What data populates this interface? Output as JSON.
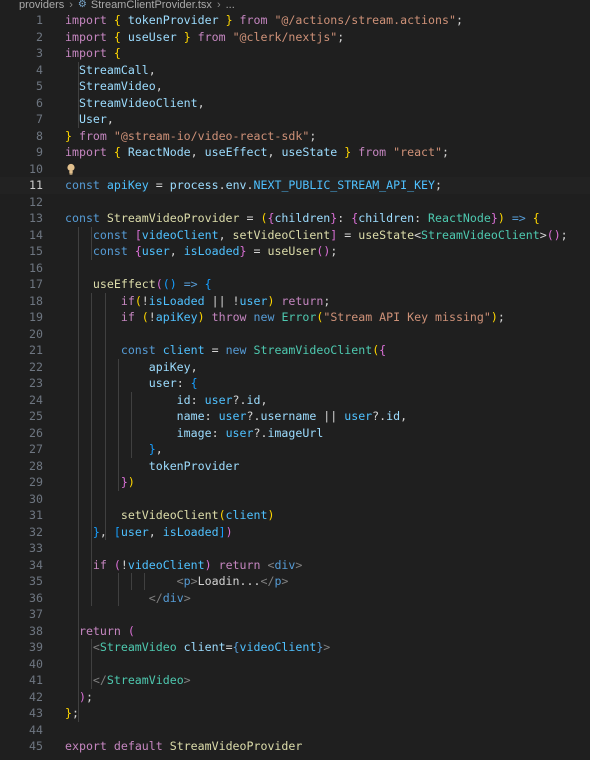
{
  "breadcrumb": {
    "folder": "providers",
    "file_icon": "gear-icon",
    "file": "StreamClientProvider.tsx",
    "more": "..."
  },
  "editor": {
    "active_line": 11,
    "lightbulb_line": 10,
    "lines": [
      {
        "n": "1",
        "tokens": [
          [
            "import",
            "ctl"
          ],
          [
            " ",
            "txt"
          ],
          [
            "{",
            "br1"
          ],
          [
            " ",
            "txt"
          ],
          [
            "tokenProvider",
            "var"
          ],
          [
            " ",
            "txt"
          ],
          [
            "}",
            "br1"
          ],
          [
            " ",
            "txt"
          ],
          [
            "from",
            "ctl"
          ],
          [
            " ",
            "txt"
          ],
          [
            "\"@/actions/stream.actions\"",
            "str"
          ],
          [
            ";",
            "txt"
          ]
        ]
      },
      {
        "n": "2",
        "tokens": [
          [
            "import",
            "ctl"
          ],
          [
            " ",
            "txt"
          ],
          [
            "{",
            "br1"
          ],
          [
            " ",
            "txt"
          ],
          [
            "useUser",
            "var"
          ],
          [
            " ",
            "txt"
          ],
          [
            "}",
            "br1"
          ],
          [
            " ",
            "txt"
          ],
          [
            "from",
            "ctl"
          ],
          [
            " ",
            "txt"
          ],
          [
            "\"@clerk/nextjs\"",
            "str"
          ],
          [
            ";",
            "txt"
          ]
        ]
      },
      {
        "n": "3",
        "tokens": [
          [
            "import",
            "ctl"
          ],
          [
            " ",
            "txt"
          ],
          [
            "{",
            "br1"
          ]
        ]
      },
      {
        "n": "4",
        "tokens": [
          [
            "  StreamCall",
            "var"
          ],
          [
            ",",
            "txt"
          ]
        ]
      },
      {
        "n": "5",
        "tokens": [
          [
            "  StreamVideo",
            "var"
          ],
          [
            ",",
            "txt"
          ]
        ]
      },
      {
        "n": "6",
        "tokens": [
          [
            "  StreamVideoClient",
            "var"
          ],
          [
            ",",
            "txt"
          ]
        ]
      },
      {
        "n": "7",
        "tokens": [
          [
            "  User",
            "var"
          ],
          [
            ",",
            "txt"
          ]
        ]
      },
      {
        "n": "8",
        "tokens": [
          [
            "}",
            "br1"
          ],
          [
            " ",
            "txt"
          ],
          [
            "from",
            "ctl"
          ],
          [
            " ",
            "txt"
          ],
          [
            "\"@stream-io/video-react-sdk\"",
            "str"
          ],
          [
            ";",
            "txt"
          ]
        ]
      },
      {
        "n": "9",
        "tokens": [
          [
            "import",
            "ctl"
          ],
          [
            " ",
            "txt"
          ],
          [
            "{",
            "br1"
          ],
          [
            " ",
            "txt"
          ],
          [
            "ReactNode",
            "var"
          ],
          [
            ", ",
            "txt"
          ],
          [
            "useEffect",
            "var"
          ],
          [
            ", ",
            "txt"
          ],
          [
            "useState",
            "var"
          ],
          [
            " ",
            "txt"
          ],
          [
            "}",
            "br1"
          ],
          [
            " ",
            "txt"
          ],
          [
            "from",
            "ctl"
          ],
          [
            " ",
            "txt"
          ],
          [
            "\"react\"",
            "str"
          ],
          [
            ";",
            "txt"
          ]
        ]
      },
      {
        "n": "10",
        "tokens": []
      },
      {
        "n": "11",
        "tokens": [
          [
            "const",
            "kw"
          ],
          [
            " ",
            "txt"
          ],
          [
            "apiKey",
            "const"
          ],
          [
            " = ",
            "txt"
          ],
          [
            "process",
            "var"
          ],
          [
            ".",
            "txt"
          ],
          [
            "env",
            "var"
          ],
          [
            ".",
            "txt"
          ],
          [
            "NEXT_PUBLIC_STREAM_API_KEY",
            "const"
          ],
          [
            ";",
            "txt"
          ]
        ]
      },
      {
        "n": "12",
        "tokens": []
      },
      {
        "n": "13",
        "tokens": [
          [
            "const",
            "kw"
          ],
          [
            " ",
            "txt"
          ],
          [
            "StreamVideoProvider",
            "fn"
          ],
          [
            " = ",
            "txt"
          ],
          [
            "(",
            "br1"
          ],
          [
            "{",
            "br2"
          ],
          [
            "children",
            "var"
          ],
          [
            "}",
            "br2"
          ],
          [
            ": ",
            "txt"
          ],
          [
            "{",
            "br2"
          ],
          [
            "children",
            "var"
          ],
          [
            ": ",
            "txt"
          ],
          [
            "ReactNode",
            "cls"
          ],
          [
            "}",
            "br2"
          ],
          [
            ")",
            "br1"
          ],
          [
            " ",
            "txt"
          ],
          [
            "=>",
            "kw"
          ],
          [
            " ",
            "txt"
          ],
          [
            "{",
            "br1"
          ]
        ]
      },
      {
        "n": "14",
        "tokens": [
          [
            "    const",
            "kw"
          ],
          [
            " ",
            "txt"
          ],
          [
            "[",
            "br2"
          ],
          [
            "videoClient",
            "const"
          ],
          [
            ", ",
            "txt"
          ],
          [
            "setVideoClient",
            "fn"
          ],
          [
            "]",
            "br2"
          ],
          [
            " = ",
            "txt"
          ],
          [
            "useState",
            "fn"
          ],
          [
            "<",
            "txt"
          ],
          [
            "StreamVideoClient",
            "cls"
          ],
          [
            ">",
            "txt"
          ],
          [
            "(",
            "br2"
          ],
          [
            ")",
            "br2"
          ],
          [
            ";",
            "txt"
          ]
        ]
      },
      {
        "n": "15",
        "tokens": [
          [
            "    const",
            "kw"
          ],
          [
            " ",
            "txt"
          ],
          [
            "{",
            "br2"
          ],
          [
            "user",
            "const"
          ],
          [
            ", ",
            "txt"
          ],
          [
            "isLoaded",
            "const"
          ],
          [
            "}",
            "br2"
          ],
          [
            " = ",
            "txt"
          ],
          [
            "useUser",
            "fn"
          ],
          [
            "(",
            "br2"
          ],
          [
            ")",
            "br2"
          ],
          [
            ";",
            "txt"
          ]
        ]
      },
      {
        "n": "16",
        "tokens": []
      },
      {
        "n": "17",
        "tokens": [
          [
            "    useEffect",
            "fn"
          ],
          [
            "(",
            "br2"
          ],
          [
            "(",
            "br3"
          ],
          [
            ")",
            "br3"
          ],
          [
            " ",
            "txt"
          ],
          [
            "=>",
            "kw"
          ],
          [
            " ",
            "txt"
          ],
          [
            "{",
            "br3"
          ]
        ]
      },
      {
        "n": "18",
        "tokens": [
          [
            "        if",
            "ctl"
          ],
          [
            "(",
            "br1"
          ],
          [
            "!",
            "txt"
          ],
          [
            "isLoaded",
            "const"
          ],
          [
            " || ",
            "txt"
          ],
          [
            "!",
            "txt"
          ],
          [
            "user",
            "const"
          ],
          [
            ")",
            "br1"
          ],
          [
            " ",
            "txt"
          ],
          [
            "return",
            "ctl"
          ],
          [
            ";",
            "txt"
          ]
        ]
      },
      {
        "n": "19",
        "tokens": [
          [
            "        if",
            "ctl"
          ],
          [
            " ",
            "txt"
          ],
          [
            "(",
            "br1"
          ],
          [
            "!",
            "txt"
          ],
          [
            "apiKey",
            "const"
          ],
          [
            ")",
            "br1"
          ],
          [
            " ",
            "txt"
          ],
          [
            "throw",
            "ctl"
          ],
          [
            " ",
            "txt"
          ],
          [
            "new",
            "kw"
          ],
          [
            " ",
            "txt"
          ],
          [
            "Error",
            "cls"
          ],
          [
            "(",
            "br1"
          ],
          [
            "\"Stream API Key missing\"",
            "str"
          ],
          [
            ")",
            "br1"
          ],
          [
            ";",
            "txt"
          ]
        ]
      },
      {
        "n": "20",
        "tokens": []
      },
      {
        "n": "21",
        "tokens": [
          [
            "        const",
            "kw"
          ],
          [
            " ",
            "txt"
          ],
          [
            "client",
            "const"
          ],
          [
            " = ",
            "txt"
          ],
          [
            "new",
            "kw"
          ],
          [
            " ",
            "txt"
          ],
          [
            "StreamVideoClient",
            "cls"
          ],
          [
            "(",
            "br1"
          ],
          [
            "{",
            "br2"
          ]
        ]
      },
      {
        "n": "22",
        "tokens": [
          [
            "            apiKey",
            "var"
          ],
          [
            ",",
            "txt"
          ]
        ]
      },
      {
        "n": "23",
        "tokens": [
          [
            "            user",
            "var"
          ],
          [
            ": ",
            "txt"
          ],
          [
            "{",
            "br3"
          ]
        ]
      },
      {
        "n": "24",
        "tokens": [
          [
            "                id",
            "var"
          ],
          [
            ": ",
            "txt"
          ],
          [
            "user",
            "const"
          ],
          [
            "?.",
            "txt"
          ],
          [
            "id",
            "var"
          ],
          [
            ",",
            "txt"
          ]
        ]
      },
      {
        "n": "25",
        "tokens": [
          [
            "                name",
            "var"
          ],
          [
            ": ",
            "txt"
          ],
          [
            "user",
            "const"
          ],
          [
            "?.",
            "txt"
          ],
          [
            "username",
            "var"
          ],
          [
            " || ",
            "txt"
          ],
          [
            "user",
            "const"
          ],
          [
            "?.",
            "txt"
          ],
          [
            "id",
            "var"
          ],
          [
            ",",
            "txt"
          ]
        ]
      },
      {
        "n": "26",
        "tokens": [
          [
            "                image",
            "var"
          ],
          [
            ": ",
            "txt"
          ],
          [
            "user",
            "const"
          ],
          [
            "?.",
            "txt"
          ],
          [
            "imageUrl",
            "var"
          ]
        ]
      },
      {
        "n": "27",
        "tokens": [
          [
            "            }",
            "br3"
          ],
          [
            ",",
            "txt"
          ]
        ]
      },
      {
        "n": "28",
        "tokens": [
          [
            "            tokenProvider",
            "var"
          ]
        ]
      },
      {
        "n": "29",
        "tokens": [
          [
            "        }",
            "br2"
          ],
          [
            ")",
            "br1"
          ]
        ]
      },
      {
        "n": "30",
        "tokens": []
      },
      {
        "n": "31",
        "tokens": [
          [
            "        setVideoClient",
            "fn"
          ],
          [
            "(",
            "br1"
          ],
          [
            "client",
            "const"
          ],
          [
            ")",
            "br1"
          ]
        ]
      },
      {
        "n": "32",
        "tokens": [
          [
            "    }",
            "br3"
          ],
          [
            ", ",
            "txt"
          ],
          [
            "[",
            "br3"
          ],
          [
            "user",
            "const"
          ],
          [
            ", ",
            "txt"
          ],
          [
            "isLoaded",
            "const"
          ],
          [
            "]",
            "br3"
          ],
          [
            ")",
            "br2"
          ]
        ]
      },
      {
        "n": "33",
        "tokens": []
      },
      {
        "n": "34",
        "tokens": [
          [
            "    if",
            "ctl"
          ],
          [
            " ",
            "txt"
          ],
          [
            "(",
            "br2"
          ],
          [
            "!",
            "txt"
          ],
          [
            "videoClient",
            "const"
          ],
          [
            ")",
            "br2"
          ],
          [
            " ",
            "txt"
          ],
          [
            "return",
            "ctl"
          ],
          [
            " ",
            "txt"
          ],
          [
            "<",
            "tag"
          ],
          [
            "div",
            "kw"
          ],
          [
            ">",
            "tag"
          ]
        ]
      },
      {
        "n": "35",
        "tokens": [
          [
            "                <",
            "tag"
          ],
          [
            "p",
            "kw"
          ],
          [
            ">",
            "tag"
          ],
          [
            "Loadin...",
            "txt"
          ],
          [
            "</",
            "tag"
          ],
          [
            "p",
            "kw"
          ],
          [
            ">",
            "tag"
          ]
        ]
      },
      {
        "n": "36",
        "tokens": [
          [
            "            </",
            "tag"
          ],
          [
            "div",
            "kw"
          ],
          [
            ">",
            "tag"
          ]
        ]
      },
      {
        "n": "37",
        "tokens": []
      },
      {
        "n": "38",
        "tokens": [
          [
            "  return",
            "ctl"
          ],
          [
            " ",
            "txt"
          ],
          [
            "(",
            "br2"
          ]
        ]
      },
      {
        "n": "39",
        "tokens": [
          [
            "    <",
            "tag"
          ],
          [
            "StreamVideo",
            "cls"
          ],
          [
            " ",
            "txt"
          ],
          [
            "client",
            "var"
          ],
          [
            "=",
            "txt"
          ],
          [
            "{",
            "kw"
          ],
          [
            "videoClient",
            "const"
          ],
          [
            "}",
            "kw"
          ],
          [
            ">",
            "tag"
          ]
        ]
      },
      {
        "n": "40",
        "tokens": []
      },
      {
        "n": "41",
        "tokens": [
          [
            "    </",
            "tag"
          ],
          [
            "StreamVideo",
            "cls"
          ],
          [
            ">",
            "tag"
          ]
        ]
      },
      {
        "n": "42",
        "tokens": [
          [
            "  )",
            "br2"
          ],
          [
            ";",
            "txt"
          ]
        ]
      },
      {
        "n": "43",
        "tokens": [
          [
            "}",
            "br1"
          ],
          [
            ";",
            "txt"
          ]
        ]
      },
      {
        "n": "44",
        "tokens": []
      },
      {
        "n": "45",
        "tokens": [
          [
            "export",
            "ctl"
          ],
          [
            " ",
            "txt"
          ],
          [
            "default",
            "ctl"
          ],
          [
            " ",
            "txt"
          ],
          [
            "StreamVideoProvider",
            "fn"
          ]
        ]
      }
    ]
  }
}
